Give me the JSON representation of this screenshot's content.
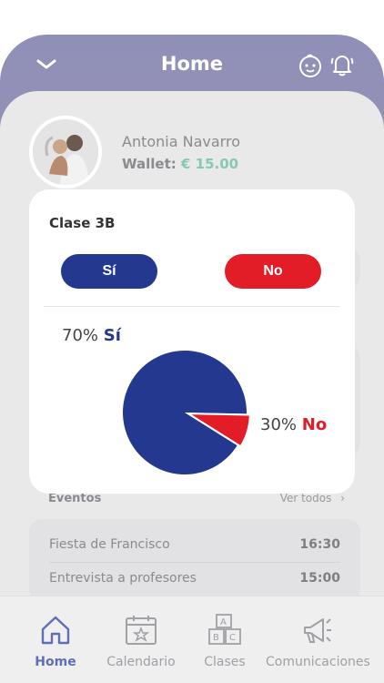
{
  "header": {
    "title": "Home"
  },
  "profile": {
    "name": "Antonia Navarro",
    "wallet_label": "Wallet:",
    "wallet_amount": "€ 15.00"
  },
  "modal": {
    "class_name": "Clase 3B",
    "yes_label": "Sí",
    "no_label": "No",
    "yes_percent": "70%",
    "yes_text": "Sí",
    "no_percent": "30%",
    "no_text": "No"
  },
  "chart_data": {
    "type": "pie",
    "categories": [
      "Sí",
      "No"
    ],
    "values": [
      70,
      30
    ],
    "colors": [
      "#24388f",
      "#e31d27"
    ]
  },
  "events": {
    "heading": "Eventos",
    "see_all": "Ver todos",
    "items": [
      {
        "title": "Fiesta de Francisco",
        "time": "16:30"
      },
      {
        "title": "Entrevista a profesores",
        "time": "15:00"
      }
    ]
  },
  "nav": {
    "items": [
      {
        "label": "Home",
        "icon": "home-icon"
      },
      {
        "label": "Calendario",
        "icon": "calendar-icon"
      },
      {
        "label": "Clases",
        "icon": "abc-blocks-icon"
      },
      {
        "label": "Comunicaciones",
        "icon": "megaphone-icon"
      }
    ]
  }
}
